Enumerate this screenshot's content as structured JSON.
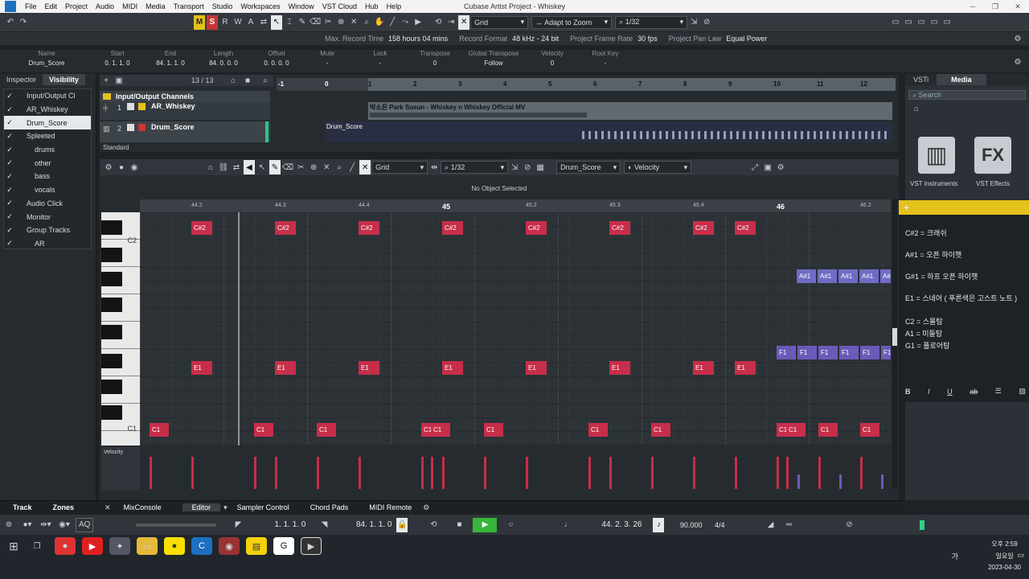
{
  "window": {
    "title": "Cubase Artist Project - Whiskey"
  },
  "menu": [
    "File",
    "Edit",
    "Project",
    "Audio",
    "MIDI",
    "Media",
    "Transport",
    "Studio",
    "Workspaces",
    "Window",
    "VST Cloud",
    "Hub",
    "Help"
  ],
  "toolbar": {
    "m": "M",
    "s": "S",
    "r": "R",
    "w": "W",
    "a": "A",
    "grid": "Grid",
    "adapt": "Adapt to Zoom",
    "quant": "1/32"
  },
  "infobar": {
    "max_record_label": "Max. Record Time",
    "max_record": "158 hours 04 mins",
    "record_format_label": "Record Format",
    "record_format": "48 kHz - 24 bit",
    "frame_rate_label": "Project Frame Rate",
    "frame_rate": "30 fps",
    "pan_law_label": "Project Pan Law",
    "pan_law": "Equal Power"
  },
  "trackinfo": {
    "fields": [
      {
        "h": "Name",
        "v": "Drum_Score"
      },
      {
        "h": "Start",
        "v": "0. 1. 1. 0"
      },
      {
        "h": "End",
        "v": "84. 1. 1. 0"
      },
      {
        "h": "Length",
        "v": "84. 0. 0. 0"
      },
      {
        "h": "Offset",
        "v": "0. 0. 0. 0"
      },
      {
        "h": "Mute",
        "v": "-"
      },
      {
        "h": "Lock",
        "v": "-"
      },
      {
        "h": "Transpose",
        "v": "0"
      },
      {
        "h": "Global Transpose",
        "v": "Follow"
      },
      {
        "h": "Velocity",
        "v": "0"
      },
      {
        "h": "Root Key",
        "v": "-"
      }
    ]
  },
  "inspector": {
    "tab_inspector": "Inspector",
    "tab_visibility": "Visibility",
    "items": [
      {
        "label": "Input/Output Cl",
        "indent": 1
      },
      {
        "label": "AR_Whiskey",
        "indent": 1
      },
      {
        "label": "Drum_Score",
        "indent": 1,
        "selected": true
      },
      {
        "label": "Spleeted",
        "indent": 1
      },
      {
        "label": "drums",
        "indent": 2
      },
      {
        "label": "other",
        "indent": 2
      },
      {
        "label": "bass",
        "indent": 2
      },
      {
        "label": "vocals",
        "indent": 2
      },
      {
        "label": "Audio Click",
        "indent": 1
      },
      {
        "label": "Monitor",
        "indent": 1
      },
      {
        "label": "Group Tracks",
        "indent": 1
      },
      {
        "label": "AR",
        "indent": 2
      }
    ]
  },
  "project": {
    "counter": "13 / 13",
    "folder": "Input/Output Channels",
    "track1": "AR_Whiskey",
    "track2": "Drum_Score",
    "standard": "Standard",
    "audio_event": "박소은 Park Soeun - Whiskey n Whiskey Official MV",
    "midi_event": "Drum_Score",
    "ruler": [
      "-1",
      "0",
      "1",
      "2",
      "3",
      "4",
      "5",
      "6",
      "7",
      "8",
      "9",
      "10",
      "11",
      "12"
    ],
    "track1_num": "1",
    "track2_num": "2"
  },
  "editor": {
    "grid": "Grid",
    "quant": "1/32",
    "track_select": "Drum_Score",
    "lane": "Velocity",
    "status": "No Object Selected",
    "velocity_label": "Velocity",
    "ruler": [
      "44.2",
      "44.3",
      "44.4",
      "45",
      "45.2",
      "45.3",
      "45.4",
      "46",
      "46.2"
    ],
    "key_c2": "C2",
    "key_c1": "C1",
    "notes_csharp": [
      "C#2",
      "C#2",
      "C#2",
      "C#2",
      "C#2",
      "C#2",
      "C#2",
      "C#2"
    ],
    "notes_e1": [
      "E1",
      "E1",
      "E1",
      "E1",
      "E1",
      "E1",
      "E1",
      "E1"
    ],
    "notes_c1": [
      "C1",
      "C1",
      "C1",
      "C1",
      "C1",
      "C1",
      "C1",
      "C1",
      "C1",
      "C1",
      "C1",
      "C1"
    ],
    "notes_asharp": [
      "A#1",
      "A#1",
      "A#1",
      "A#1",
      "A#"
    ],
    "notes_f1": [
      "F1",
      "F1",
      "F1",
      "F1",
      "F1",
      "F1"
    ]
  },
  "media": {
    "tab_vsti": "VSTi",
    "tab_media": "Media",
    "search": "Search",
    "instruments": "VST Instruments",
    "effects": "VST Effects",
    "fx": "FX"
  },
  "notepad": {
    "lines": [
      "C#2 = 크래쉬",
      "A#1 = 오픈 하이햇",
      "G#1 = 하프 오픈 하이햇",
      "E1 = 스네어 ( 푸른색은 고스트 노트 )",
      "C2 = 스몰탐",
      "A1 = 미들탐",
      "G1 = 플로어탐"
    ],
    "fmt": [
      "B",
      "I",
      "U"
    ]
  },
  "bottomtabs": {
    "track": "Track",
    "zones": "Zones",
    "mixconsole": "MixConsole",
    "editor": "Editor",
    "sampler": "Sampler Control",
    "chordpads": "Chord Pads",
    "midiremote": "MIDI Remote"
  },
  "transport": {
    "left_locator": "1. 1. 1. 0",
    "right_locator": "84. 1. 1. 0",
    "position": "44. 2. 3. 26",
    "tempo": "90.000",
    "signature": "4/4",
    "aq": "AQ"
  },
  "taskbar": {
    "time": "오후 2:59",
    "day": "일요일",
    "date": "2023-04-30",
    "lang": "가"
  },
  "colors": {
    "note_red": "#c72e4a",
    "note_purple": "#6b5bb8",
    "accent_yellow": "#e4c21c"
  }
}
